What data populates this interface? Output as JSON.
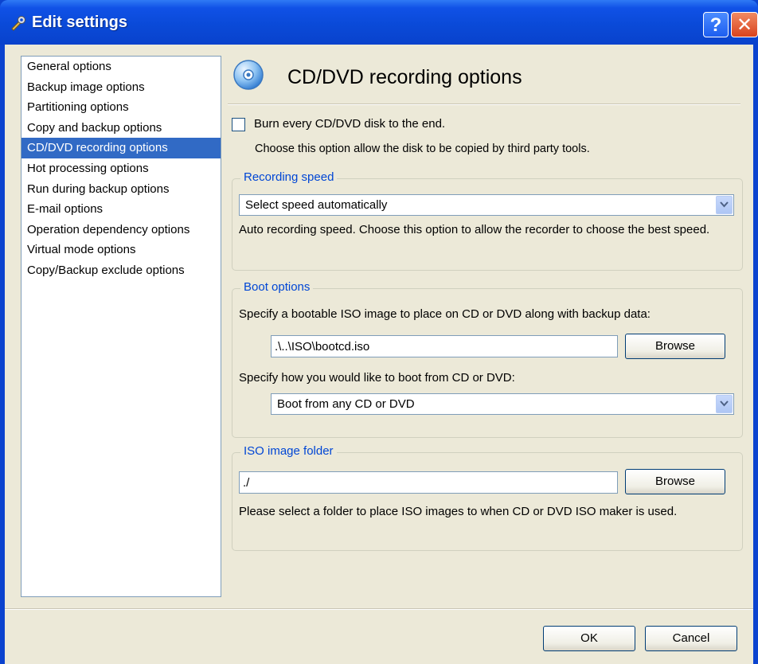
{
  "window": {
    "title": "Edit settings",
    "help_label": "?",
    "close_label": "✕"
  },
  "nav": {
    "items": [
      "General options",
      "Backup image options",
      "Partitioning options",
      "Copy and backup options",
      "CD/DVD recording options",
      "Hot processing options",
      "Run during backup options",
      "E-mail options",
      "Operation dependency options",
      "Virtual mode options",
      "Copy/Backup exclude options"
    ],
    "selected_index": 4
  },
  "page": {
    "title": "CD/DVD recording options",
    "icon": "cd-icon"
  },
  "burn": {
    "label": "Burn every CD/DVD disk to the end.",
    "checked": false,
    "description": "Choose this option allow the disk to be copied by third party tools."
  },
  "recording_speed": {
    "legend": "Recording speed",
    "selected": "Select speed automatically",
    "description": "Auto recording speed. Choose this option to allow the recorder to choose the best speed."
  },
  "boot": {
    "legend": "Boot options",
    "iso_label": "Specify a bootable ISO image to place on CD or DVD along with backup data:",
    "iso_path": ".\\..\\ISO\\bootcd.iso",
    "browse_label": "Browse",
    "boot_label": "Specify how you would like to boot from CD or DVD:",
    "boot_selected": "Boot from any CD or DVD"
  },
  "iso_folder": {
    "legend": "ISO image folder",
    "path": "./",
    "browse_label": "Browse",
    "description": "Please select a folder to place ISO images to when CD or DVD ISO maker is used."
  },
  "buttons": {
    "ok": "OK",
    "cancel": "Cancel"
  },
  "colors": {
    "titlebar": "#0a4ad8",
    "selection": "#316ac5",
    "legend_text": "#0046d5",
    "dialog_bg": "#ece9d8"
  }
}
